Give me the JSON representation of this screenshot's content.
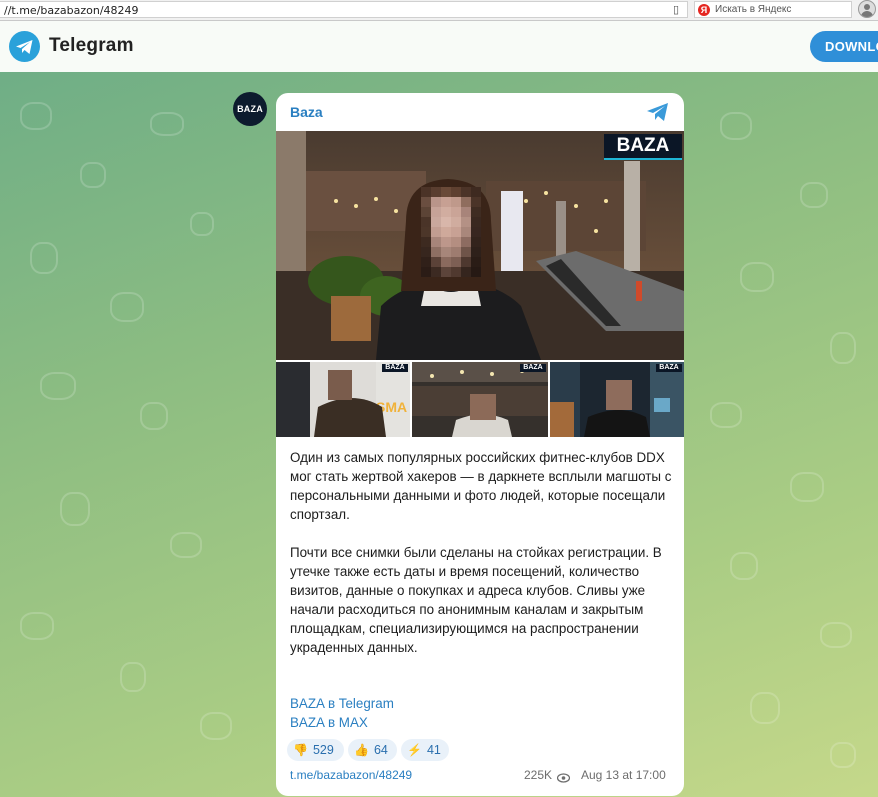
{
  "browser": {
    "url": "//t.me/bazabazon/48249",
    "search_placeholder": "Искать в Яндекс",
    "yandex_letter": "Я"
  },
  "header": {
    "brand": "Telegram",
    "download_label": "DOWNLO"
  },
  "post": {
    "avatar_label": "BAZA",
    "channel_name": "Baza",
    "watermark": "BAZA",
    "paragraphs": [
      "Один из самых популярных российских фитнес-клубов DDX мог стать жертвой хакеров — в даркнете всплыли магшоты с персональными данными и фото людей, которые посещали спортзал.",
      "Почти все снимки были сделаны на стойках регистрации. В утечке также есть даты и время посещений, количество визитов, данные о покупках и адреса клубов. Сливы уже начали расходиться по анонимным каналам и закрытым площадкам, специализирующимся на распространении украденных данных."
    ],
    "links": [
      "BAZA в Telegram",
      "BAZA в MAX"
    ],
    "reactions": [
      {
        "emoji": "👎",
        "count": "529"
      },
      {
        "emoji": "👍",
        "count": "64"
      },
      {
        "emoji": "⚡",
        "count": "41"
      }
    ],
    "footer_link": "t.me/bazabazon/48249",
    "views": "225K",
    "date": "Aug 13 at 17:00"
  },
  "colors": {
    "accent": "#2a7fc1",
    "download_button": "#2f8fd8"
  }
}
